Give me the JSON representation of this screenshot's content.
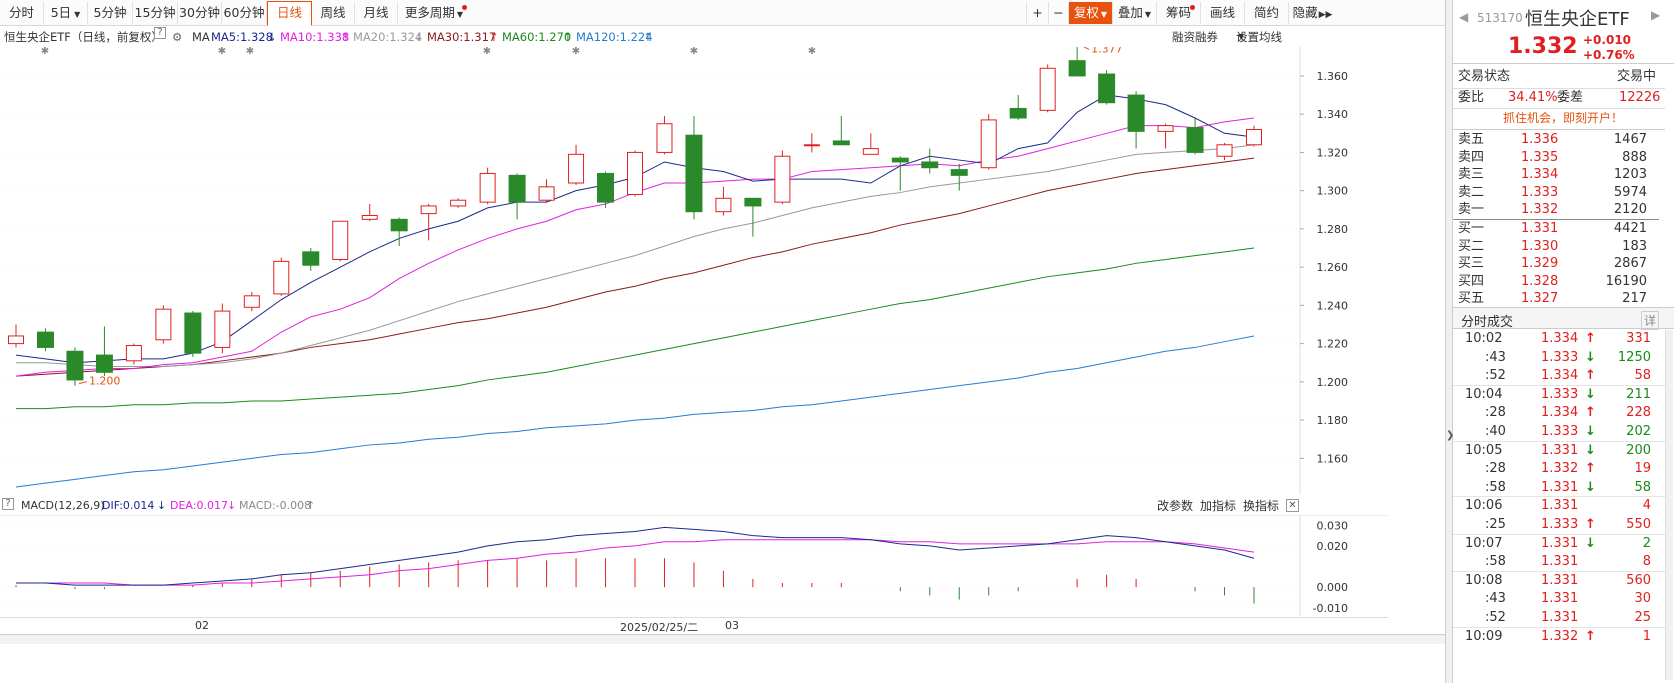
{
  "toolbar": {
    "periods": [
      "分时",
      "5日",
      "5分钟",
      "15分钟",
      "30分钟",
      "60分钟",
      "日线",
      "周线",
      "月线",
      "更多周期"
    ],
    "active_period": "日线",
    "right_tools": [
      "+",
      "−",
      "复权",
      "叠加",
      "筹码",
      "画线",
      "简约",
      "隐藏"
    ],
    "fuquan_label": "复权"
  },
  "legend": {
    "title": "恒生央企ETF（日线，前复权）",
    "ma_label": "MA",
    "ma5": "MA5:1.328",
    "ma10": "MA10:1.338",
    "ma20": "MA20:1.324",
    "ma30": "MA30:1.317",
    "ma60": "MA60:1.270",
    "ma120": "MA120:1.224",
    "margin_link": "融资融券",
    "settings_link": "设置均线"
  },
  "colors": {
    "up": "#e02020",
    "down": "#2a8a2a",
    "ma5": "#1a2a8a",
    "ma10": "#e020e0",
    "ma20": "#999999",
    "ma30": "#8a1a1a",
    "ma60": "#1a8a1a",
    "ma120": "#2a7ad0",
    "accent": "#e8520f"
  },
  "chart_data": [
    {
      "type": "candlestick",
      "title": "恒生央企ETF（日线，前复权）",
      "y_ticks": [
        "1.360",
        "1.340",
        "1.320",
        "1.300",
        "1.280",
        "1.260",
        "1.240",
        "1.220",
        "1.200",
        "1.180",
        "1.160"
      ],
      "ylim": [
        1.145,
        1.372
      ],
      "high_annotation": "1.377",
      "low_annotation": "1.200",
      "candles": [
        {
          "o": 1.22,
          "h": 1.23,
          "l": 1.218,
          "c": 1.224
        },
        {
          "o": 1.226,
          "h": 1.228,
          "l": 1.216,
          "c": 1.218
        },
        {
          "o": 1.216,
          "h": 1.218,
          "l": 1.198,
          "c": 1.201
        },
        {
          "o": 1.214,
          "h": 1.229,
          "l": 1.203,
          "c": 1.205
        },
        {
          "o": 1.211,
          "h": 1.22,
          "l": 1.209,
          "c": 1.219
        },
        {
          "o": 1.222,
          "h": 1.24,
          "l": 1.22,
          "c": 1.238
        },
        {
          "o": 1.236,
          "h": 1.237,
          "l": 1.213,
          "c": 1.215
        },
        {
          "o": 1.218,
          "h": 1.241,
          "l": 1.215,
          "c": 1.237
        },
        {
          "o": 1.239,
          "h": 1.247,
          "l": 1.237,
          "c": 1.245
        },
        {
          "o": 1.246,
          "h": 1.265,
          "l": 1.245,
          "c": 1.263
        },
        {
          "o": 1.268,
          "h": 1.27,
          "l": 1.258,
          "c": 1.261
        },
        {
          "o": 1.264,
          "h": 1.284,
          "l": 1.263,
          "c": 1.284
        },
        {
          "o": 1.285,
          "h": 1.293,
          "l": 1.284,
          "c": 1.287
        },
        {
          "o": 1.285,
          "h": 1.286,
          "l": 1.271,
          "c": 1.279
        },
        {
          "o": 1.288,
          "h": 1.293,
          "l": 1.274,
          "c": 1.292
        },
        {
          "o": 1.292,
          "h": 1.296,
          "l": 1.291,
          "c": 1.295
        },
        {
          "o": 1.294,
          "h": 1.312,
          "l": 1.293,
          "c": 1.309
        },
        {
          "o": 1.308,
          "h": 1.309,
          "l": 1.285,
          "c": 1.294
        },
        {
          "o": 1.295,
          "h": 1.306,
          "l": 1.294,
          "c": 1.302
        },
        {
          "o": 1.304,
          "h": 1.324,
          "l": 1.303,
          "c": 1.319
        },
        {
          "o": 1.309,
          "h": 1.31,
          "l": 1.291,
          "c": 1.294
        },
        {
          "o": 1.298,
          "h": 1.321,
          "l": 1.297,
          "c": 1.32
        },
        {
          "o": 1.32,
          "h": 1.339,
          "l": 1.319,
          "c": 1.335
        },
        {
          "o": 1.329,
          "h": 1.339,
          "l": 1.285,
          "c": 1.289
        },
        {
          "o": 1.289,
          "h": 1.302,
          "l": 1.287,
          "c": 1.296
        },
        {
          "o": 1.296,
          "h": 1.296,
          "l": 1.276,
          "c": 1.292
        },
        {
          "o": 1.294,
          "h": 1.321,
          "l": 1.293,
          "c": 1.318
        },
        {
          "o": 1.324,
          "h": 1.33,
          "l": 1.32,
          "c": 1.324
        },
        {
          "o": 1.326,
          "h": 1.339,
          "l": 1.324,
          "c": 1.324
        },
        {
          "o": 1.319,
          "h": 1.33,
          "l": 1.319,
          "c": 1.322
        },
        {
          "o": 1.317,
          "h": 1.318,
          "l": 1.3,
          "c": 1.315
        },
        {
          "o": 1.315,
          "h": 1.322,
          "l": 1.309,
          "c": 1.312
        },
        {
          "o": 1.311,
          "h": 1.314,
          "l": 1.3,
          "c": 1.308
        },
        {
          "o": 1.312,
          "h": 1.34,
          "l": 1.311,
          "c": 1.337
        },
        {
          "o": 1.343,
          "h": 1.35,
          "l": 1.337,
          "c": 1.338
        },
        {
          "o": 1.342,
          "h": 1.366,
          "l": 1.341,
          "c": 1.364
        },
        {
          "o": 1.368,
          "h": 1.377,
          "l": 1.36,
          "c": 1.36
        },
        {
          "o": 1.361,
          "h": 1.363,
          "l": 1.345,
          "c": 1.346
        },
        {
          "o": 1.35,
          "h": 1.352,
          "l": 1.322,
          "c": 1.331
        },
        {
          "o": 1.331,
          "h": 1.335,
          "l": 1.322,
          "c": 1.334
        },
        {
          "o": 1.333,
          "h": 1.338,
          "l": 1.319,
          "c": 1.32
        },
        {
          "o": 1.318,
          "h": 1.325,
          "l": 1.316,
          "c": 1.324
        },
        {
          "o": 1.324,
          "h": 1.334,
          "l": 1.323,
          "c": 1.332
        }
      ],
      "ma5": [
        1.214,
        1.212,
        1.21,
        1.211,
        1.212,
        1.212,
        1.215,
        1.221,
        1.232,
        1.243,
        1.252,
        1.26,
        1.268,
        1.275,
        1.28,
        1.284,
        1.291,
        1.294,
        1.294,
        1.3,
        1.303,
        1.307,
        1.315,
        1.312,
        1.31,
        1.305,
        1.306,
        1.306,
        1.306,
        1.304,
        1.313,
        1.318,
        1.316,
        1.314,
        1.322,
        1.325,
        1.341,
        1.35,
        1.348,
        1.345,
        1.338,
        1.33,
        1.328
      ],
      "ma10": [
        1.203,
        1.205,
        1.206,
        1.207,
        1.207,
        1.209,
        1.21,
        1.213,
        1.216,
        1.226,
        1.234,
        1.238,
        1.244,
        1.254,
        1.262,
        1.269,
        1.275,
        1.28,
        1.284,
        1.29,
        1.293,
        1.299,
        1.304,
        1.304,
        1.305,
        1.306,
        1.306,
        1.31,
        1.311,
        1.312,
        1.313,
        1.314,
        1.313,
        1.316,
        1.318,
        1.322,
        1.326,
        1.33,
        1.334,
        1.334,
        1.333,
        1.336,
        1.338
      ],
      "ma20": [
        1.21,
        1.21,
        1.209,
        1.208,
        1.208,
        1.208,
        1.209,
        1.21,
        1.212,
        1.215,
        1.219,
        1.223,
        1.227,
        1.232,
        1.237,
        1.242,
        1.246,
        1.25,
        1.254,
        1.258,
        1.262,
        1.266,
        1.271,
        1.276,
        1.28,
        1.283,
        1.287,
        1.291,
        1.294,
        1.297,
        1.299,
        1.302,
        1.304,
        1.306,
        1.308,
        1.31,
        1.313,
        1.316,
        1.319,
        1.32,
        1.321,
        1.322,
        1.324
      ],
      "ma30": [
        1.203,
        1.204,
        1.205,
        1.206,
        1.207,
        1.208,
        1.209,
        1.211,
        1.213,
        1.215,
        1.218,
        1.22,
        1.222,
        1.225,
        1.228,
        1.231,
        1.233,
        1.236,
        1.239,
        1.243,
        1.247,
        1.25,
        1.254,
        1.257,
        1.261,
        1.265,
        1.268,
        1.272,
        1.275,
        1.278,
        1.282,
        1.285,
        1.288,
        1.292,
        1.296,
        1.3,
        1.303,
        1.306,
        1.309,
        1.311,
        1.313,
        1.315,
        1.317
      ],
      "ma60": [
        1.186,
        1.186,
        1.187,
        1.187,
        1.188,
        1.188,
        1.189,
        1.189,
        1.19,
        1.19,
        1.191,
        1.192,
        1.193,
        1.194,
        1.196,
        1.198,
        1.201,
        1.203,
        1.205,
        1.208,
        1.211,
        1.214,
        1.217,
        1.22,
        1.223,
        1.226,
        1.229,
        1.232,
        1.235,
        1.238,
        1.241,
        1.243,
        1.246,
        1.249,
        1.252,
        1.255,
        1.257,
        1.259,
        1.262,
        1.264,
        1.266,
        1.268,
        1.27
      ],
      "ma120": [
        1.145,
        1.147,
        1.149,
        1.151,
        1.153,
        1.154,
        1.156,
        1.158,
        1.16,
        1.162,
        1.163,
        1.165,
        1.167,
        1.168,
        1.17,
        1.171,
        1.173,
        1.174,
        1.176,
        1.177,
        1.178,
        1.18,
        1.181,
        1.183,
        1.184,
        1.185,
        1.187,
        1.188,
        1.19,
        1.192,
        1.194,
        1.196,
        1.198,
        1.2,
        1.202,
        1.205,
        1.207,
        1.21,
        1.213,
        1.216,
        1.218,
        1.221,
        1.224
      ]
    },
    {
      "type": "macd",
      "title": "MACD(12,26,9)",
      "dif_label": "DIF:0.014",
      "dea_label": "DEA:0.017",
      "macd_label": "MACD:-0.008",
      "y_ticks": [
        "0.030",
        "0.020",
        "0.000",
        "-0.010"
      ],
      "ylim": [
        -0.013,
        0.034
      ],
      "dif": [
        0.002,
        0.002,
        0.001,
        0.001,
        0.001,
        0.001,
        0.002,
        0.003,
        0.004,
        0.006,
        0.007,
        0.009,
        0.011,
        0.013,
        0.015,
        0.017,
        0.02,
        0.022,
        0.023,
        0.025,
        0.026,
        0.027,
        0.029,
        0.028,
        0.027,
        0.025,
        0.024,
        0.024,
        0.024,
        0.023,
        0.021,
        0.02,
        0.018,
        0.019,
        0.02,
        0.021,
        0.023,
        0.025,
        0.024,
        0.022,
        0.02,
        0.018,
        0.014
      ],
      "dea": [
        0.002,
        0.002,
        0.002,
        0.002,
        0.001,
        0.001,
        0.001,
        0.002,
        0.002,
        0.003,
        0.004,
        0.005,
        0.006,
        0.008,
        0.009,
        0.011,
        0.013,
        0.014,
        0.016,
        0.017,
        0.019,
        0.02,
        0.022,
        0.022,
        0.023,
        0.023,
        0.023,
        0.023,
        0.023,
        0.023,
        0.022,
        0.022,
        0.021,
        0.021,
        0.021,
        0.021,
        0.021,
        0.022,
        0.022,
        0.022,
        0.021,
        0.019,
        0.017
      ],
      "macd": [
        0.001,
        0.0,
        -0.001,
        -0.001,
        0.0,
        0.0,
        0.001,
        0.002,
        0.004,
        0.006,
        0.007,
        0.008,
        0.01,
        0.011,
        0.012,
        0.013,
        0.013,
        0.014,
        0.013,
        0.014,
        0.014,
        0.014,
        0.014,
        0.012,
        0.008,
        0.004,
        0.002,
        0.002,
        0.002,
        0.0,
        -0.002,
        -0.004,
        -0.006,
        -0.004,
        -0.002,
        0.0,
        0.004,
        0.006,
        0.004,
        0.0,
        -0.002,
        -0.004,
        -0.008
      ]
    }
  ],
  "macd_panel": {
    "title": "MACD(12,26,9)",
    "dif": "DIF:0.014",
    "dea": "DEA:0.017",
    "macd": "MACD:-0.008",
    "links": [
      "改参数",
      "加指标",
      "换指标"
    ]
  },
  "date_axis": {
    "labels": [
      "02",
      "2025/02/25/二",
      "03"
    ]
  },
  "quote": {
    "code": "513170",
    "name": "恒生央企ETF",
    "price": "1.332",
    "change": "+0.010",
    "change_pct": "+0.76%",
    "status_label": "交易状态",
    "status_value": "交易中",
    "weibi_label": "委比",
    "weibi_value": "34.41%",
    "weicha_label": "委差",
    "weicha_value": "12226",
    "promo": "抓住机会，即刻开户！"
  },
  "order_book": {
    "asks": [
      {
        "label": "卖五",
        "price": "1.336",
        "vol": "1467"
      },
      {
        "label": "卖四",
        "price": "1.335",
        "vol": "888"
      },
      {
        "label": "卖三",
        "price": "1.334",
        "vol": "1203"
      },
      {
        "label": "卖二",
        "price": "1.333",
        "vol": "5974"
      },
      {
        "label": "卖一",
        "price": "1.332",
        "vol": "2120"
      }
    ],
    "bids": [
      {
        "label": "买一",
        "price": "1.331",
        "vol": "4421"
      },
      {
        "label": "买二",
        "price": "1.330",
        "vol": "183"
      },
      {
        "label": "买三",
        "price": "1.329",
        "vol": "2867"
      },
      {
        "label": "买四",
        "price": "1.328",
        "vol": "16190"
      },
      {
        "label": "买五",
        "price": "1.327",
        "vol": "217"
      }
    ]
  },
  "ticks": {
    "title": "分时成交",
    "detail": "详",
    "rows": [
      {
        "time": "10:02",
        "price": "1.334",
        "dir": "up",
        "vol": "331",
        "major": true
      },
      {
        "time": ":43",
        "price": "1.333",
        "dir": "down",
        "vol": "1250",
        "major": false
      },
      {
        "time": ":52",
        "price": "1.334",
        "dir": "up",
        "vol": "58",
        "major": false
      },
      {
        "time": "10:04",
        "price": "1.333",
        "dir": "down",
        "vol": "211",
        "major": true
      },
      {
        "time": ":28",
        "price": "1.334",
        "dir": "up",
        "vol": "228",
        "major": false
      },
      {
        "time": ":40",
        "price": "1.333",
        "dir": "down",
        "vol": "202",
        "major": false
      },
      {
        "time": "10:05",
        "price": "1.331",
        "dir": "down",
        "vol": "200",
        "major": true
      },
      {
        "time": ":28",
        "price": "1.332",
        "dir": "up",
        "vol": "19",
        "major": false
      },
      {
        "time": ":58",
        "price": "1.331",
        "dir": "down",
        "vol": "58",
        "major": false
      },
      {
        "time": "10:06",
        "price": "1.331",
        "dir": "none",
        "vol": "4",
        "major": true
      },
      {
        "time": ":25",
        "price": "1.333",
        "dir": "up",
        "vol": "550",
        "major": false
      },
      {
        "time": "10:07",
        "price": "1.331",
        "dir": "down",
        "vol": "2",
        "major": true
      },
      {
        "time": ":58",
        "price": "1.331",
        "dir": "none",
        "vol": "8",
        "major": false
      },
      {
        "time": "10:08",
        "price": "1.331",
        "dir": "none",
        "vol": "560",
        "major": true
      },
      {
        "time": ":43",
        "price": "1.331",
        "dir": "none",
        "vol": "30",
        "major": false
      },
      {
        "time": ":52",
        "price": "1.331",
        "dir": "none",
        "vol": "25",
        "major": false
      },
      {
        "time": "10:09",
        "price": "1.332",
        "dir": "up",
        "vol": "1",
        "major": true
      }
    ]
  }
}
